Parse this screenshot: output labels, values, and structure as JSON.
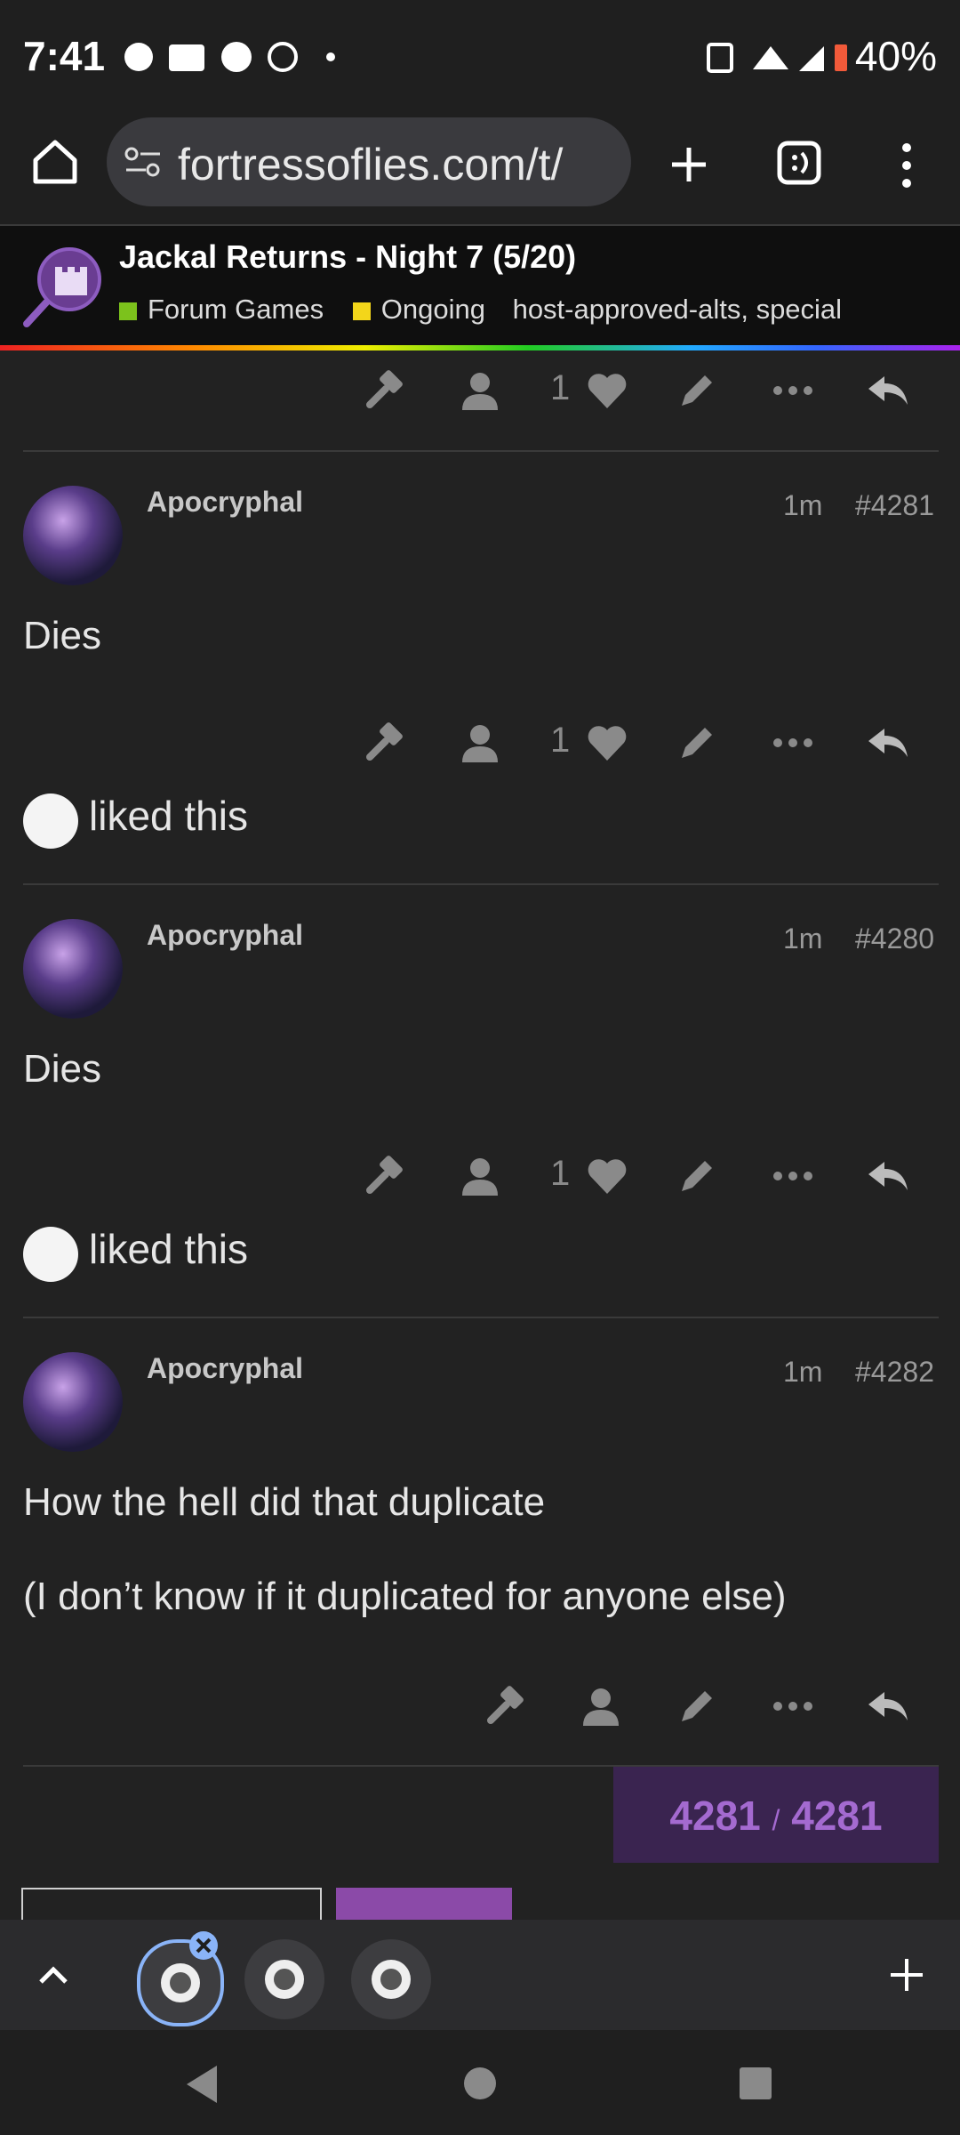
{
  "status_bar": {
    "time": "7:41",
    "battery": "40%"
  },
  "browser": {
    "url": "fortressoflies.com/t/"
  },
  "topic": {
    "title": "Jackal Returns - Night 7 (5/20)",
    "category": "Forum Games",
    "category_color": "#7cc21c",
    "status_tag": "Ongoing",
    "status_color": "#f3d61a",
    "tags": [
      "host-approved-alts",
      "special"
    ]
  },
  "top_actions": {
    "like_count": "1"
  },
  "posts": [
    {
      "username": "Apocryphal",
      "time": "1m",
      "number": "#4281",
      "body": [
        "Dies"
      ],
      "like_count": "1",
      "liked_text": "liked this"
    },
    {
      "username": "Apocryphal",
      "time": "1m",
      "number": "#4280",
      "body": [
        "Dies"
      ],
      "like_count": "1",
      "liked_text": "liked this"
    },
    {
      "username": "Apocryphal",
      "time": "1m",
      "number": "#4282",
      "body": [
        "How the hell did that duplicate",
        "(I don’t know if it duplicated for anyone else)"
      ]
    }
  ],
  "progress": {
    "current": "4281",
    "sep": "/",
    "total": "4281"
  },
  "colors": {
    "background": "#222222",
    "accent": "#a46ad0"
  }
}
